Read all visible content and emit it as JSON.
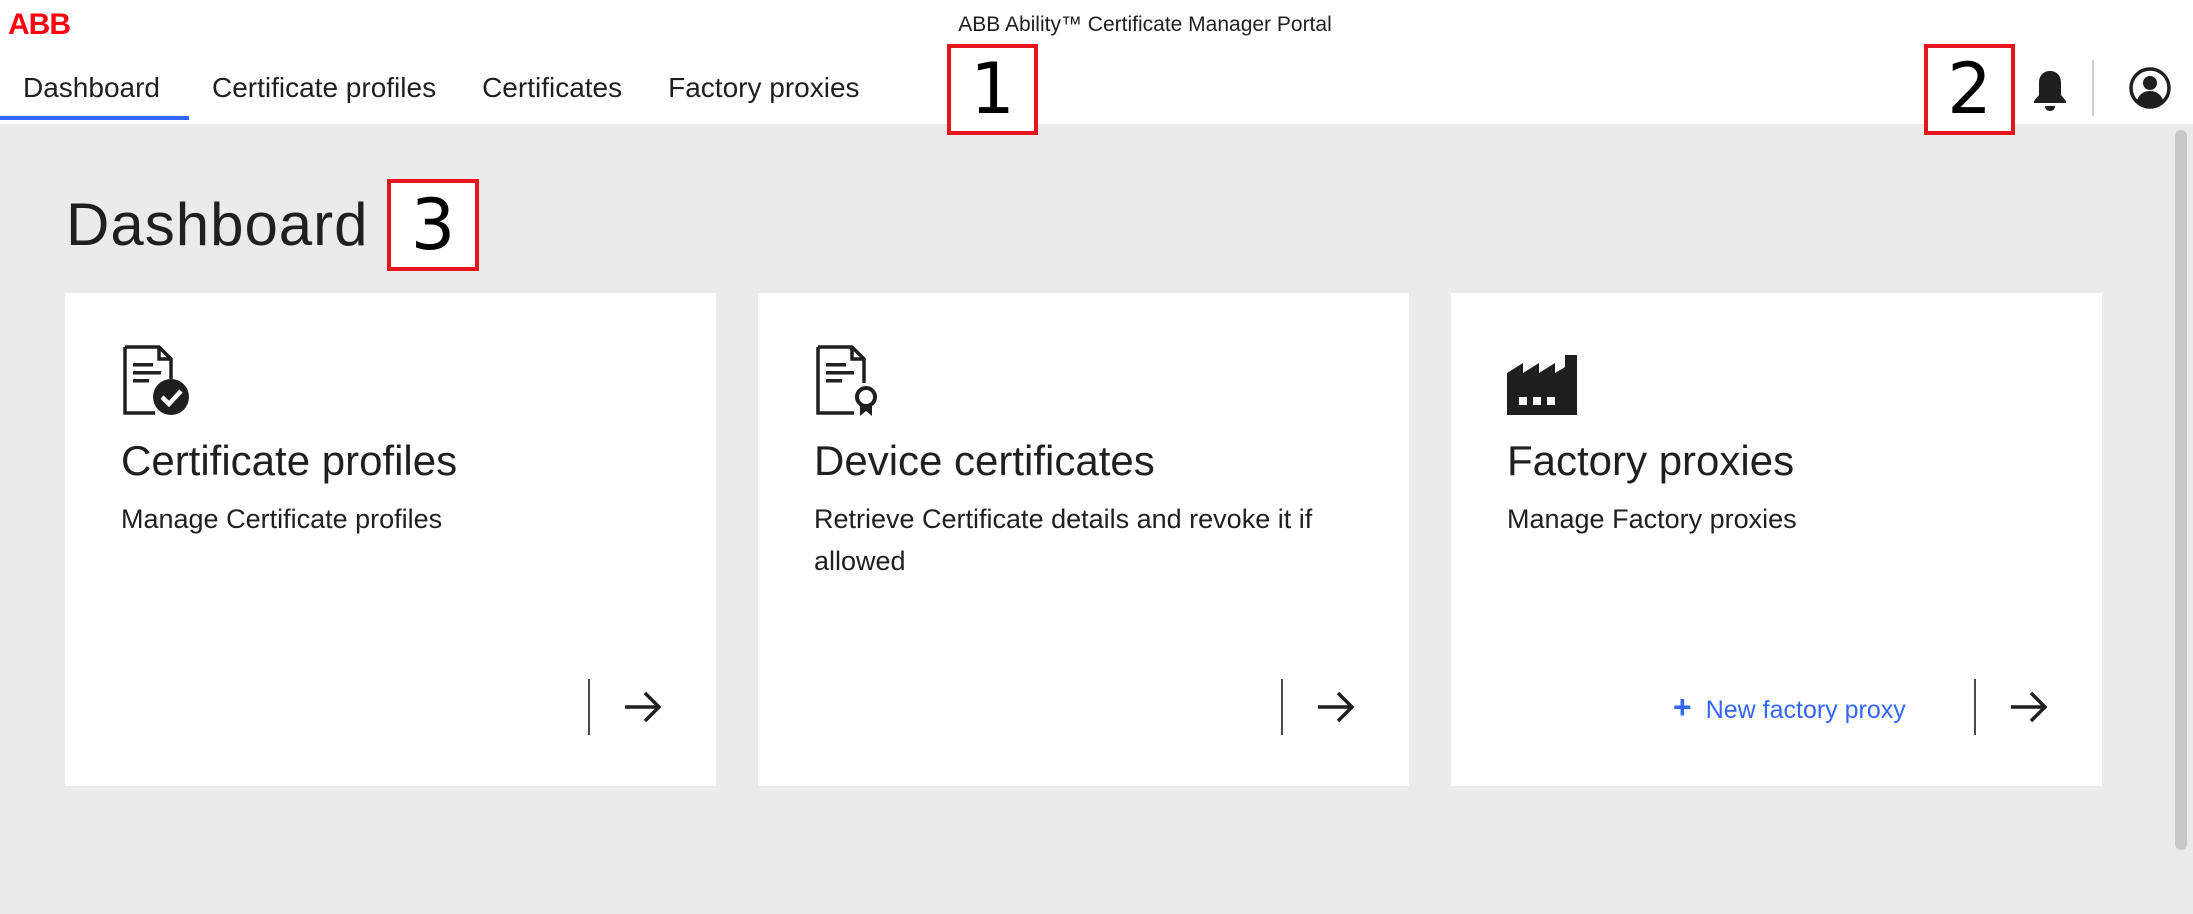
{
  "header": {
    "logo_text": "ABB",
    "app_title": "ABB Ability™ Certificate Manager Portal"
  },
  "nav": {
    "tabs": [
      {
        "label": "Dashboard",
        "active": true
      },
      {
        "label": "Certificate profiles",
        "active": false
      },
      {
        "label": "Certificates",
        "active": false
      },
      {
        "label": "Factory proxies",
        "active": false
      }
    ]
  },
  "markers": [
    "1",
    "2",
    "3"
  ],
  "page": {
    "title": "Dashboard"
  },
  "cards": [
    {
      "icon": "certificate-check-icon",
      "title": "Certificate profiles",
      "description": "Manage Certificate profiles"
    },
    {
      "icon": "certificate-ribbon-icon",
      "title": "Device certificates",
      "description": "Retrieve Certificate details and revoke it if allowed"
    },
    {
      "icon": "factory-icon",
      "title": "Factory proxies",
      "description": "Manage Factory proxies",
      "action_label": "New factory proxy"
    }
  ],
  "colors": {
    "accent": "#3366ff",
    "brand": "#ff000f",
    "marker": "#e8141c",
    "background": "#ebebeb"
  }
}
